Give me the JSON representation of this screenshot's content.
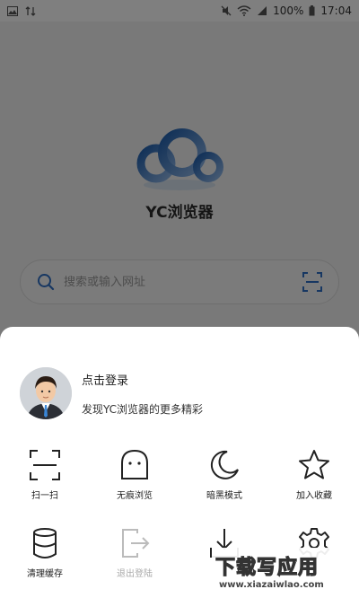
{
  "status_bar": {
    "battery_percent": "100%",
    "time": "17:04",
    "icons": [
      "image-icon",
      "data-icon",
      "mute-icon",
      "wifi-icon",
      "signal-icon",
      "battery-icon"
    ]
  },
  "app": {
    "title": "YC浏览器",
    "logo_colors": [
      "#3a78c2",
      "#8fb6e6"
    ]
  },
  "search": {
    "placeholder": "搜索或输入网址"
  },
  "sheet": {
    "profile": {
      "login_label": "点击登录",
      "subtitle": "发现YC浏览器的更多精彩"
    },
    "menu": [
      {
        "label": "扫一扫",
        "icon": "scan-icon"
      },
      {
        "label": "无痕浏览",
        "icon": "ghost-icon"
      },
      {
        "label": "暗黑模式",
        "icon": "moon-icon"
      },
      {
        "label": "加入收藏",
        "icon": "star-icon"
      },
      {
        "label": "清理缓存",
        "icon": "database-icon"
      },
      {
        "label": "退出登陆",
        "icon": "logout-icon",
        "disabled": true
      },
      {
        "label": "",
        "icon": "download-icon"
      },
      {
        "label": "",
        "icon": "settings-icon"
      }
    ]
  },
  "watermark": {
    "main": "下载写应用",
    "sub": "www.xiazaiwlao.com"
  }
}
